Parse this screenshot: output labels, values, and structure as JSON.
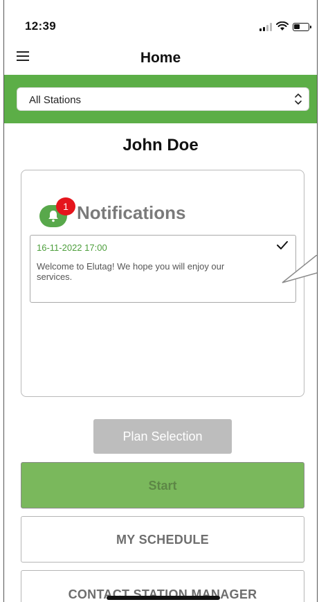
{
  "status_bar": {
    "time": "12:39",
    "icons": [
      "signal-icon",
      "wifi-icon",
      "battery-icon"
    ]
  },
  "header": {
    "menu_icon": "hamburger-menu-icon",
    "title": "Home"
  },
  "station_selector": {
    "selected": "All Stations",
    "icon": "chevron-up-down-icon"
  },
  "user": {
    "name": "John Doe"
  },
  "notifications": {
    "heading": "Notifications",
    "badge_count": "1",
    "icon": "bell-icon",
    "items": [
      {
        "date": "16-11-2022 17:00",
        "message": "Welcome to Elutag! We hope you will enjoy our services.",
        "icon": "check-icon"
      }
    ]
  },
  "actions": {
    "plan_selection": "Plan Selection",
    "start": "Start",
    "my_schedule": "MY SCHEDULE",
    "contact_manager": "CONTACT STATION MANAGER"
  },
  "colors": {
    "brand_green": "#5cae47",
    "start_green": "#7ab85c",
    "badge_red": "#e5151c",
    "date_green": "#4c9e3b",
    "disabled_gray": "#bdbdbd"
  }
}
